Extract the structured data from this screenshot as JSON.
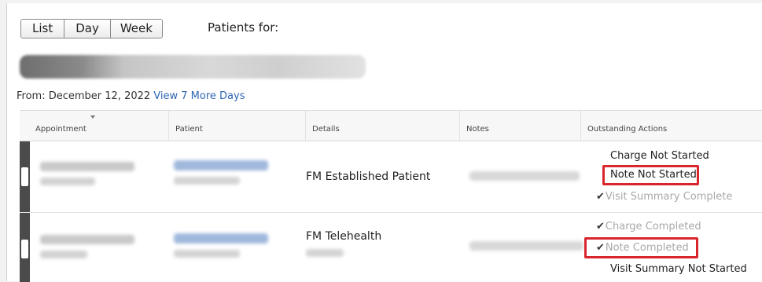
{
  "view_toggle": {
    "list_label": "List",
    "day_label": "Day",
    "week_label": "Week"
  },
  "patients_for_label": "Patients for:",
  "from_prefix": "From: December 12, 2022",
  "view_more_link": "View 7 More Days",
  "table": {
    "headers": [
      "Appointment",
      "Patient",
      "Details",
      "Notes",
      "Outstanding Actions"
    ],
    "rows": [
      {
        "details": "FM Established Patient",
        "actions": [
          {
            "text": "Charge Not Started",
            "completed": false
          },
          {
            "text": "Note Not Started",
            "completed": false,
            "highlighted": true
          },
          {
            "text": "Visit Summary Complete",
            "completed": true
          }
        ]
      },
      {
        "details": "FM Telehealth",
        "actions": [
          {
            "text": "Charge Completed",
            "completed": true
          },
          {
            "text": "Note Completed",
            "completed": true,
            "highlighted": true
          },
          {
            "text": "Visit Summary Not Started",
            "completed": false
          }
        ]
      }
    ]
  },
  "colors": {
    "link": "#2f66b3",
    "highlight_box": "#d9262c",
    "row_handle": "#4b4b4b"
  },
  "icons": {
    "completed": "checkmark-icon",
    "sort": "sort-caret-icon"
  },
  "check_glyph": "✔"
}
